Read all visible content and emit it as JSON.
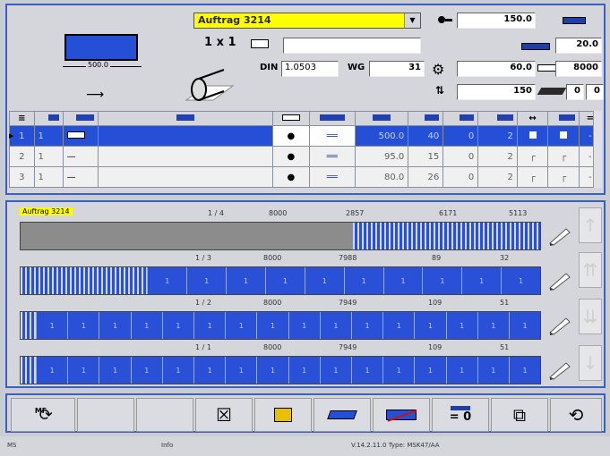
{
  "top": {
    "order_select": "Auftrag 3214",
    "multi_label": "1 x 1",
    "din_label": "DIN",
    "din_value": "1.0503",
    "wg_label": "WG",
    "wg_value": "31",
    "width_value": "150.0",
    "dim_label": "500.0",
    "right_fields": [
      "20.0",
      "8000"
    ],
    "field_60": "60.0",
    "field_150": "150",
    "small_fields": [
      "0",
      "0"
    ]
  },
  "grid": {
    "rows": [
      {
        "num": "1",
        "qty": "1",
        "v1": "500.0",
        "v2": "40",
        "v3": "0",
        "v4": "2",
        "dash": "-"
      },
      {
        "num": "2",
        "qty": "1",
        "v1": "95.0",
        "v2": "15",
        "v3": "0",
        "v4": "2",
        "dash": "-"
      },
      {
        "num": "3",
        "qty": "1",
        "v1": "80.0",
        "v2": "26",
        "v3": "0",
        "v4": "2",
        "dash": "-"
      }
    ]
  },
  "mid": {
    "order_label": "Auftrag 3214",
    "header_vals": [
      "1 / 4",
      "8000",
      "2857",
      "6171",
      "5113"
    ],
    "rows": [
      {
        "a": "1 / 3",
        "b": "8000",
        "c": "7988",
        "d": "89",
        "e": "32"
      },
      {
        "a": "1 / 2",
        "b": "8000",
        "c": "7949",
        "d": "109",
        "e": "51"
      },
      {
        "a": "1 / 1",
        "b": "8000",
        "c": "7949",
        "d": "109",
        "e": "51"
      }
    ],
    "cell_label": "1"
  },
  "bottom": {
    "mf_label": "MF",
    "counter": "= 0"
  },
  "status": {
    "left1": "MS",
    "left2": "Info",
    "version": "V.14.2.11.0  Type: MSK47/AA"
  },
  "colors": {
    "accent": "#2450d8",
    "frame": "#3d5fc4",
    "highlight": "#ffff00"
  }
}
